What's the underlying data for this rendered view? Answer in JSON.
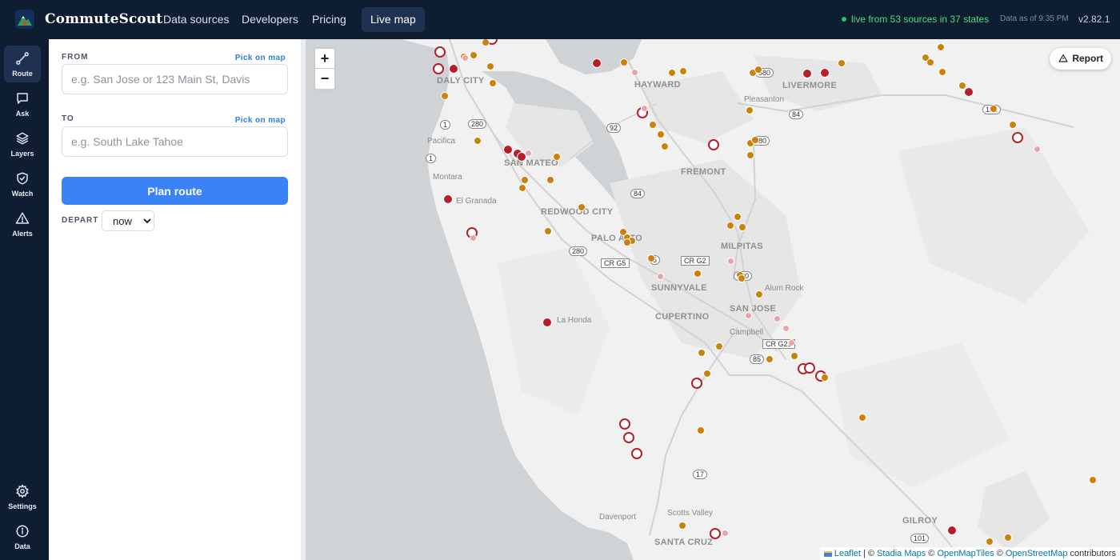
{
  "brand": {
    "name": "CommuteScout"
  },
  "nav": [
    "Data sources",
    "Developers",
    "Pricing",
    "Live map"
  ],
  "status": {
    "live_text": "live from 53 sources in 37 states",
    "data_as": "Data as of 9:35 PM",
    "version": "v2.82.1"
  },
  "rail": {
    "route": "Route",
    "ask": "Ask",
    "layers": "Layers",
    "watch": "Watch",
    "alerts": "Alerts",
    "settings": "Settings",
    "data": "Data"
  },
  "panel": {
    "from_label": "FROM",
    "from_pick": "Pick on map",
    "from_placeholder": "e.g. San Jose or 123 Main St, Davis",
    "to_label": "TO",
    "to_pick": "Pick on map",
    "to_placeholder": "e.g. South Lake Tahoe",
    "plan_button": "Plan route",
    "depart_label": "DEPART",
    "depart_value": "now"
  },
  "map": {
    "zoom_in": "+",
    "zoom_out": "−",
    "report": "Report",
    "places": {
      "daly_city": "DALY CITY",
      "hayward": "HAYWARD",
      "livermore": "LIVERMORE",
      "pleasanton": "Pleasanton",
      "pacifica": "Pacifica",
      "san_mateo": "SAN MATEO",
      "fremont": "FREMONT",
      "montara": "Montara",
      "el_granada": "El Granada",
      "redwood_city": "REDWOOD CITY",
      "palo_alto": "PALO ALTO",
      "milpitas": "MILPITAS",
      "sunnyvale": "SUNNYVALE",
      "alum_rock": "Alum Rock",
      "cupertino": "CUPERTINO",
      "san_jose": "SAN JOSE",
      "campbell": "Campbell",
      "la_honda": "La Honda",
      "scotts_valley": "Scotts Valley",
      "davenport": "Davenport",
      "santa_cruz": "SANTA CRUZ",
      "gilroy": "GILROY"
    },
    "shields": {
      "s1a": "1",
      "s1b": "1",
      "s280a": "280",
      "s280b": "280",
      "s92": "92",
      "s84a": "84",
      "s84b": "84",
      "s580": "580",
      "s680": "680",
      "s880": "880",
      "scrg5": "CR G5",
      "scrg2": "CR G2",
      "scrg21": "CR G21",
      "s85": "85",
      "s17": "17",
      "s101": "101",
      "s5": "5",
      "s132": "132"
    },
    "attribution": {
      "leaflet": "Leaflet",
      "sep": " | © ",
      "stadia": "Stadia Maps",
      "c1": " © ",
      "omt": "OpenMapTiles",
      "c2": " © ",
      "osm": "OpenStreetMap",
      "tail": " contributors"
    }
  },
  "colors": {
    "severe": "#b3202a",
    "moderate": "#c9820c",
    "minor": "#e8a4a8",
    "accent": "#3b82f6",
    "nav_bg": "#0f1d33"
  }
}
